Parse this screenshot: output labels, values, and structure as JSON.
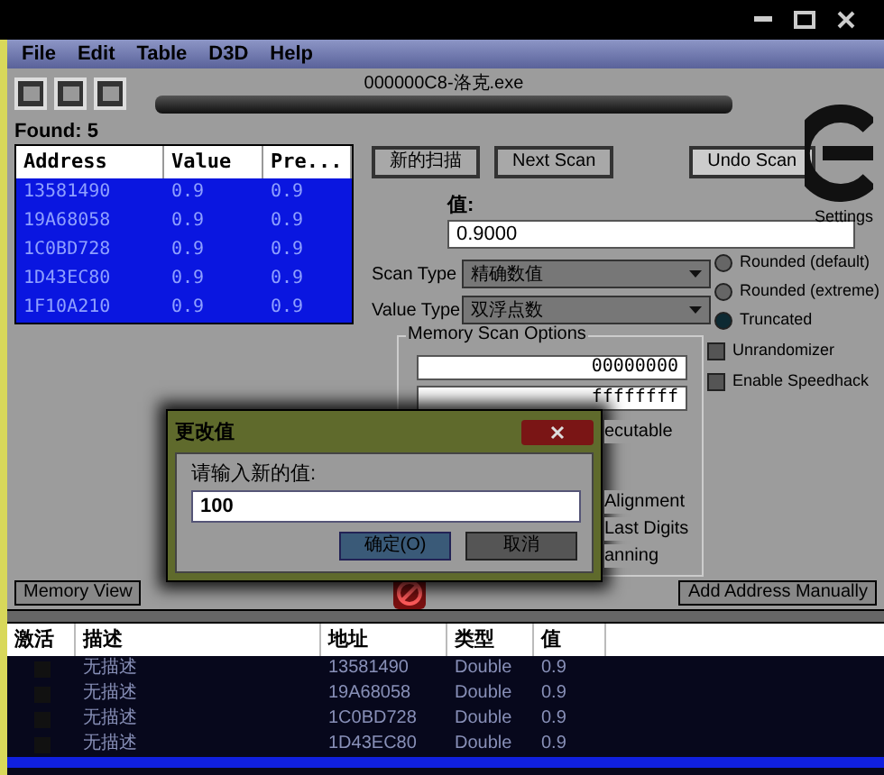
{
  "window": {
    "title": "000000C8-洛克.exe"
  },
  "menu": [
    "File",
    "Edit",
    "Table",
    "D3D",
    "Help"
  ],
  "progress": {
    "level": 0
  },
  "found": "Found: 5",
  "scan_list": {
    "columns": [
      "Address",
      "Value",
      "Pre..."
    ],
    "rows": [
      {
        "cells": [
          "13581490",
          "0.9",
          "0.9"
        ],
        "selected": true
      },
      {
        "cells": [
          "19A68058",
          "0.9",
          "0.9"
        ],
        "selected": true
      },
      {
        "cells": [
          "1C0BD728",
          "0.9",
          "0.9"
        ],
        "selected": true
      },
      {
        "cells": [
          "1D43EC80",
          "0.9",
          "0.9"
        ],
        "selected": true
      },
      {
        "cells": [
          "1F10A210",
          "0.9",
          "0.9"
        ],
        "selected": true
      }
    ]
  },
  "scan_buttons": [
    "新的扫描",
    "Next Scan",
    "Undo Scan"
  ],
  "settings_label": "Settings",
  "value_label": "值:",
  "value_field": "0.9000",
  "scan_type": {
    "label": "Scan Type",
    "value": "精确数值"
  },
  "value_type": {
    "label": "Value Type",
    "value": "双浮点数"
  },
  "rounding": [
    {
      "label": "Rounded (default)",
      "selected": false
    },
    {
      "label": "Rounded (extreme)",
      "selected": false
    },
    {
      "label": "Truncated",
      "selected": true
    }
  ],
  "options": [
    {
      "label": "Unrandomizer",
      "checked": false
    },
    {
      "label": "Enable Speedhack",
      "checked": false
    }
  ],
  "memory_scan_options": {
    "title": "Memory Scan Options",
    "start": "00000000",
    "stop": "ffffffff",
    "texts": [
      "ecutable",
      "Alignment",
      "Last Digits",
      "anning"
    ]
  },
  "dialog": {
    "title": "更改值",
    "prompt": "请输入新的值:",
    "value": "100",
    "buttons": [
      "确定(O)",
      "取消"
    ]
  },
  "memory_view_button": "Memory View",
  "add_address_button": "Add Address Manually",
  "address_table": {
    "active_column": "激活",
    "columns": [
      "描述",
      "地址",
      "类型",
      "值"
    ],
    "rows": [
      {
        "active": false,
        "cells": [
          "无描述",
          "13581490",
          "Double",
          "0.9"
        ]
      },
      {
        "active": false,
        "cells": [
          "无描述",
          "19A68058",
          "Double",
          "0.9"
        ]
      },
      {
        "active": false,
        "cells": [
          "无描述",
          "1C0BD728",
          "Double",
          "0.9"
        ]
      },
      {
        "active": false,
        "cells": [
          "无描述",
          "1D43EC80",
          "Double",
          "0.9"
        ]
      }
    ]
  }
}
